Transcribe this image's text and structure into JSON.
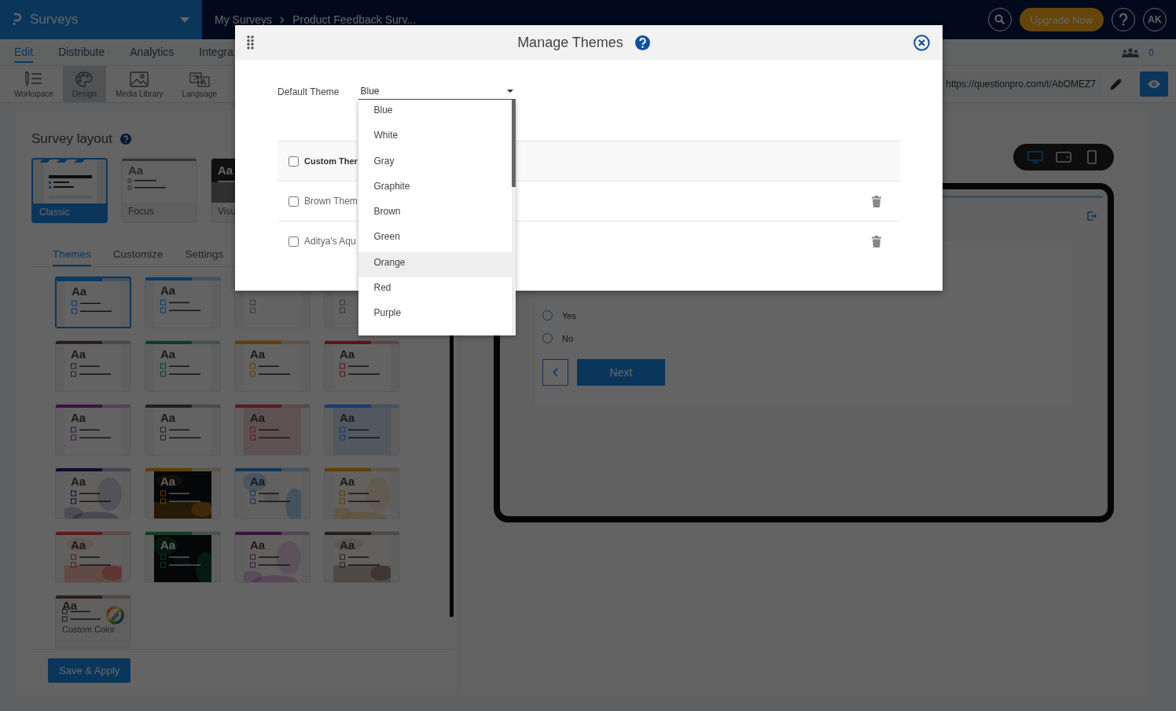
{
  "topbar": {
    "product": "Surveys",
    "breadcrumbs": [
      "My Surveys",
      "Product Feedback Surv..."
    ],
    "upgrade": "Upgrade Now",
    "avatar": "AK"
  },
  "menu": [
    {
      "label": "Edit",
      "selected": true
    },
    {
      "label": "Distribute",
      "selected": false
    },
    {
      "label": "Analytics",
      "selected": false
    },
    {
      "label": "Integra",
      "selected": false
    }
  ],
  "collaborators": "0",
  "tools": [
    {
      "kind": "workspace",
      "label": "Workspace",
      "selected": false
    },
    {
      "kind": "design",
      "label": "Design",
      "selected": true
    },
    {
      "kind": "media",
      "label": "Media Library",
      "selected": false
    },
    {
      "kind": "language",
      "label": "Language",
      "selected": false
    }
  ],
  "survey_url": "https://questionpro.com/t/AbOMEZ7",
  "layout": {
    "title": "Survey layout",
    "options": [
      {
        "kind": "classic",
        "label": "Classic",
        "selected": true
      },
      {
        "kind": "focus",
        "sample": "Aa",
        "label": "Focus",
        "selected": false
      },
      {
        "kind": "visual",
        "sample": "Aa",
        "label": "Visu",
        "selected": false
      }
    ]
  },
  "panel_tabs": [
    {
      "label": "Themes",
      "selected": true
    },
    {
      "label": "Customize",
      "selected": false
    },
    {
      "label": "Settings",
      "selected": false
    }
  ],
  "themes": [
    {
      "sample": "Aa",
      "color": "#0b3a6a",
      "kind": "plain",
      "selected": true
    },
    {
      "sample": "Aa",
      "color": "#0b3a6a",
      "kind": "plain",
      "selected": false
    },
    {
      "kind": "plain",
      "selected": false
    },
    {
      "kind": "plain",
      "selected": false
    },
    {
      "sample": "Aa",
      "color": "#2c1e1a",
      "kind": "plain",
      "selected": false
    },
    {
      "sample": "Aa",
      "color": "#0c4024",
      "kind": "plain",
      "selected": false
    },
    {
      "sample": "Aa",
      "color": "#613e07",
      "kind": "plain",
      "selected": false
    },
    {
      "sample": "Aa",
      "color": "#5a1612",
      "kind": "plain",
      "selected": false
    },
    {
      "sample": "Aa",
      "color": "#3e1046",
      "kind": "plain",
      "selected": false
    },
    {
      "sample": "Aa",
      "color": "#1e2024",
      "kind": "plain",
      "selected": false
    },
    {
      "sample": "Aa",
      "color": "#5a1a24",
      "kind": "tinted",
      "selected": false
    },
    {
      "sample": "Aa",
      "color": "#183a7a",
      "kind": "tinted",
      "selected": false
    },
    {
      "sample": "Aa",
      "color": "#0a0e32",
      "kind": "picture",
      "selected": false
    },
    {
      "sample": "Aa",
      "color": "#613e07",
      "kind": "dark",
      "selected": false
    },
    {
      "sample": "Aa",
      "color": "#0c365c",
      "kind": "picture",
      "selected": false
    },
    {
      "sample": "Aa",
      "color": "#613e07",
      "kind": "picture",
      "selected": false
    },
    {
      "sample": "Aa",
      "color": "#5a1e17",
      "kind": "picture",
      "selected": false
    },
    {
      "sample": "Aa",
      "color": "#0c4024",
      "kind": "dark",
      "selected": false
    },
    {
      "sample": "Aa",
      "color": "#3e1046",
      "kind": "picture",
      "selected": false
    },
    {
      "sample": "Aa",
      "color": "#2c1e1a",
      "kind": "picture",
      "selected": false
    }
  ],
  "custom_color": {
    "sample": "Aa",
    "label": "Custom Color",
    "color": "#2c1e1a"
  },
  "save_button": "Save & Apply",
  "devices": [
    {
      "kind": "desktop",
      "selected": true
    },
    {
      "kind": "tablet",
      "selected": false
    },
    {
      "kind": "phone",
      "selected": false
    }
  ],
  "preview": {
    "options": [
      {
        "label": "Yes",
        "checked": false
      },
      {
        "label": "No",
        "checked": false
      }
    ],
    "next": "Next"
  },
  "modal": {
    "title": "Manage Themes",
    "default_label": "Default Theme",
    "default_value": "Blue",
    "dropdown": [
      {
        "label": "Blue",
        "highlighted": false
      },
      {
        "label": "White",
        "highlighted": false
      },
      {
        "label": "Gray",
        "highlighted": false
      },
      {
        "label": "Graphite",
        "highlighted": false
      },
      {
        "label": "Brown",
        "highlighted": false
      },
      {
        "label": "Green",
        "highlighted": false
      },
      {
        "label": "Orange",
        "highlighted": true
      },
      {
        "label": "Red",
        "highlighted": false
      },
      {
        "label": "Purple",
        "highlighted": false
      }
    ],
    "header": {
      "label": "Custom Ther",
      "checked": false
    },
    "rows": [
      {
        "name": "Brown Them",
        "checked": false
      },
      {
        "name": "Aditya's Aqu",
        "checked": false
      }
    ]
  }
}
